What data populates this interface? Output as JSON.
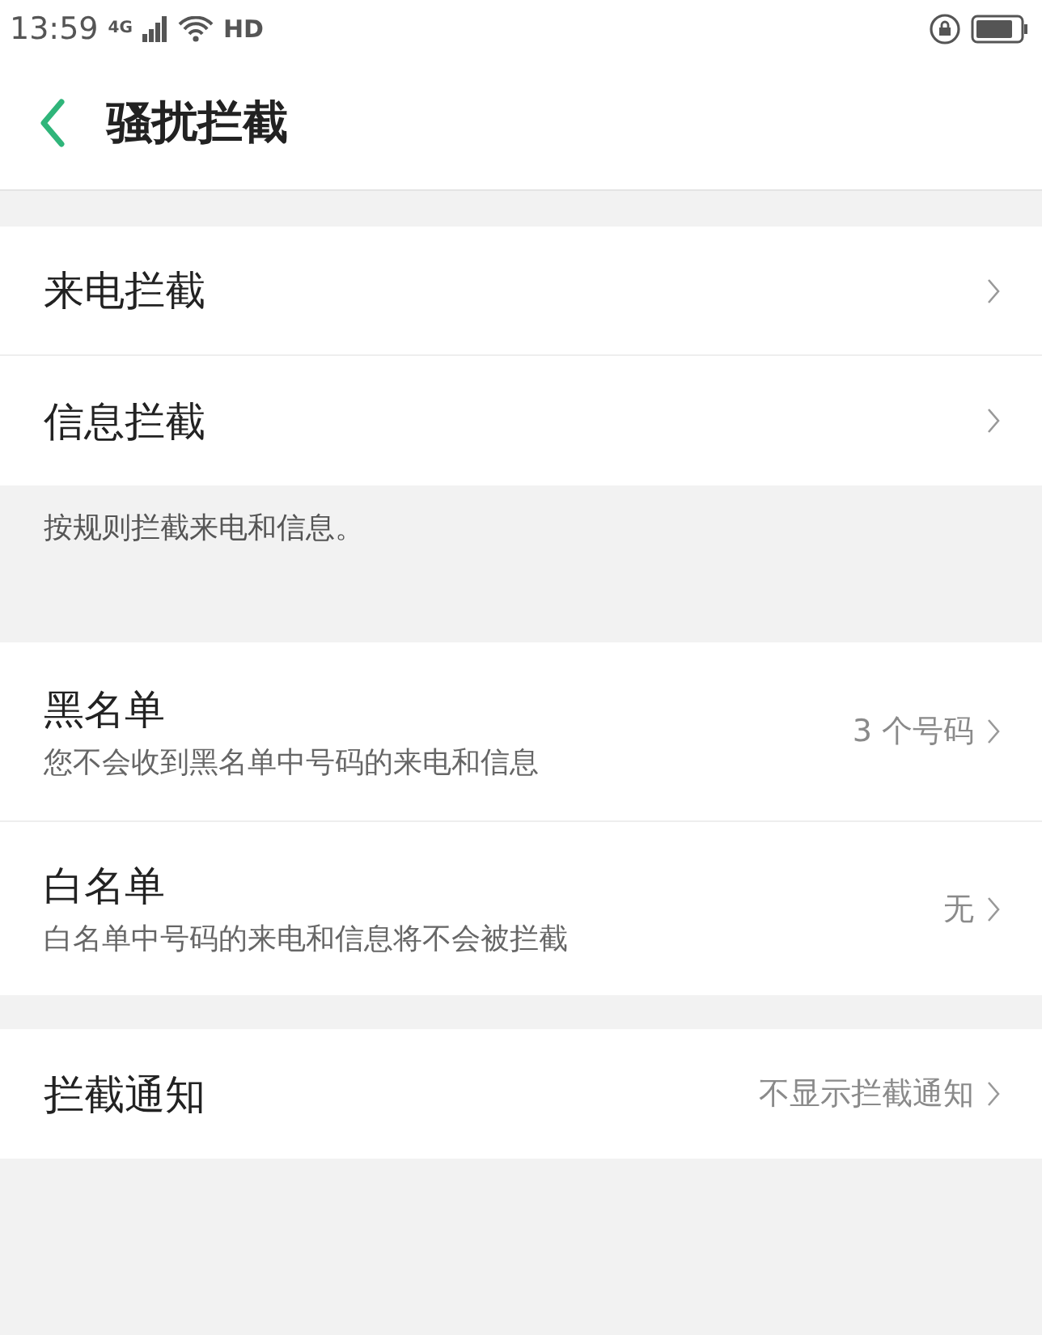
{
  "status_bar": {
    "time": "13:59",
    "network": "4G",
    "hd": "HD"
  },
  "header": {
    "title": "骚扰拦截"
  },
  "sections": [
    {
      "items": [
        {
          "label": "来电拦截"
        },
        {
          "label": "信息拦截"
        }
      ],
      "footer": "按规则拦截来电和信息。"
    },
    {
      "items": [
        {
          "label": "黑名单",
          "subtitle": "您不会收到黑名单中号码的来电和信息",
          "value": "3 个号码"
        },
        {
          "label": "白名单",
          "subtitle": "白名单中号码的来电和信息将不会被拦截",
          "value": "无"
        }
      ]
    },
    {
      "items": [
        {
          "label": "拦截通知",
          "value": "不显示拦截通知"
        }
      ]
    }
  ]
}
